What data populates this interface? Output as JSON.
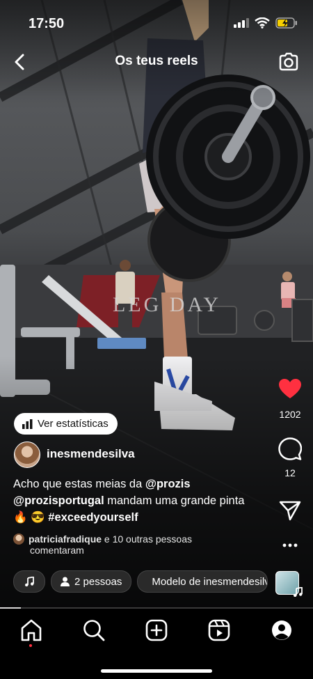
{
  "status_bar": {
    "time": "17:50"
  },
  "header": {
    "title": "Os teus reels"
  },
  "video": {
    "overlay_text": "LEG DAY"
  },
  "stats_button": {
    "label": "Ver estatísticas"
  },
  "author": {
    "username": "inesmendesilva"
  },
  "caption": {
    "line1_text": "Acho que estas meias da ",
    "line1_mention": "@prozis",
    "line2_mention": "@prozisportugal",
    "line2_text": " mandam uma grande pinta",
    "line3_emoji": "🔥 😎 ",
    "line3_hashtag": "#exceedyourself"
  },
  "commenters": {
    "user": "patriciafradique",
    "rest": " e 10 outras pessoas",
    "line2": "comentaram"
  },
  "chips": {
    "people": "2 pessoas",
    "template": "Modelo de inesmendesilva"
  },
  "actions": {
    "likes": "1202",
    "comments": "12"
  },
  "colors": {
    "like": "#ff3040",
    "accent_dot": "#ff3040"
  },
  "icons": [
    "back-icon",
    "camera-icon",
    "chart-icon",
    "heart-icon",
    "comment-icon",
    "share-icon",
    "more-icon",
    "music-icon",
    "person-icon",
    "template-icon",
    "home-icon",
    "search-icon",
    "create-icon",
    "reels-icon",
    "profile-icon"
  ]
}
